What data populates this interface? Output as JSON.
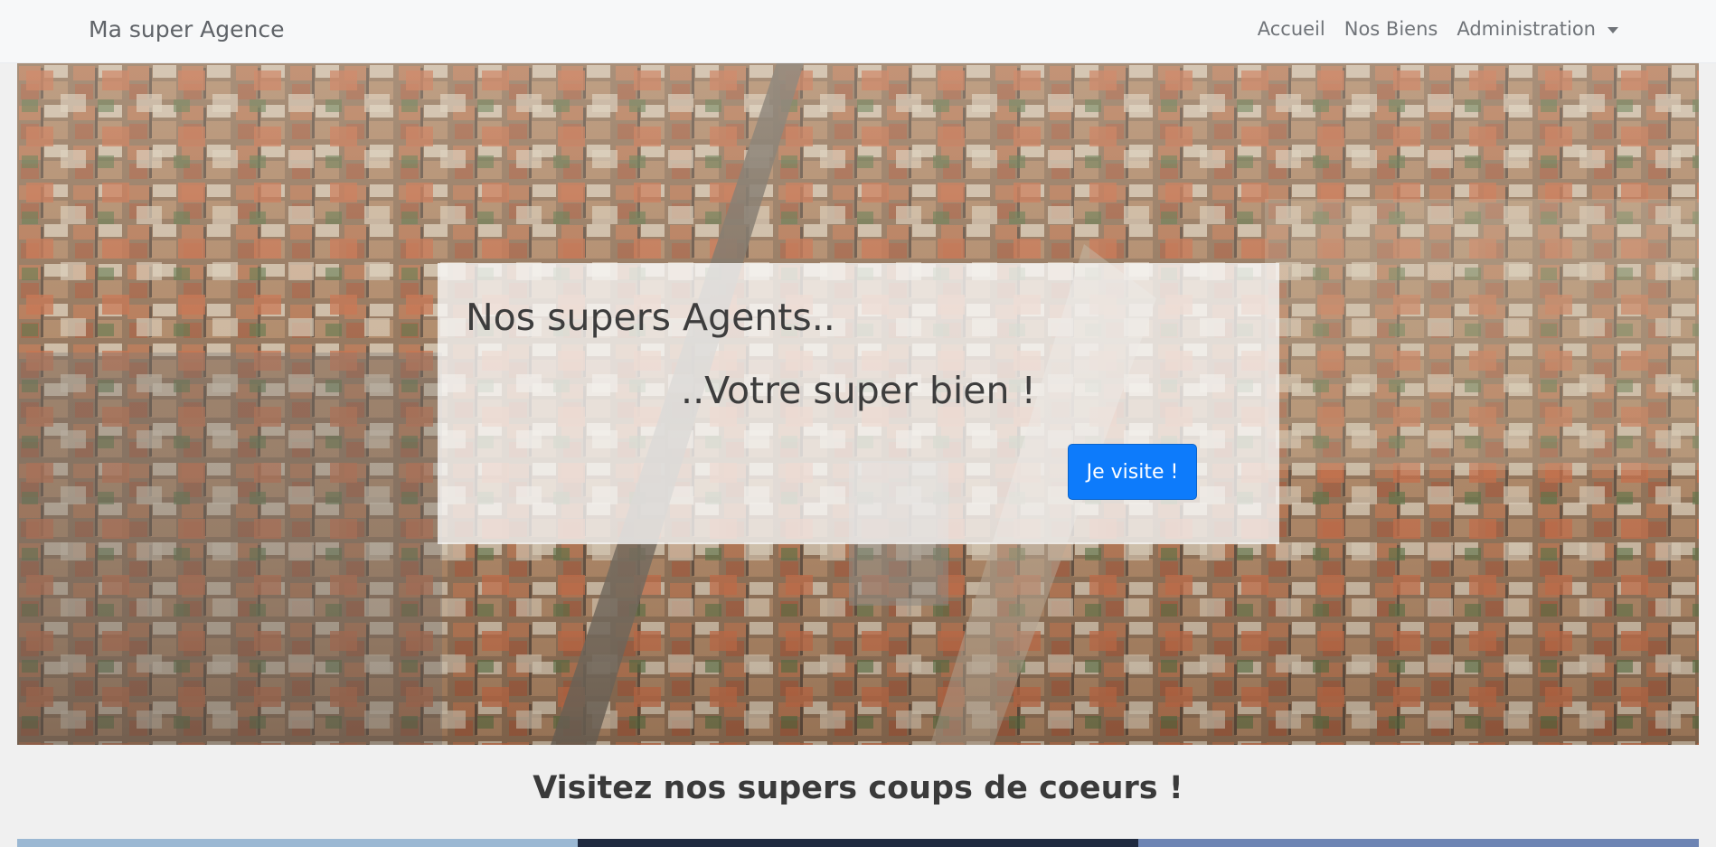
{
  "navbar": {
    "brand": "Ma super Agence",
    "links": [
      "Accueil",
      "Nos Biens"
    ],
    "dropdown_label": "Administration"
  },
  "hero": {
    "title": "Nos supers Agents..",
    "subtitle": "..Votre super bien !",
    "button_label": "Je visite !",
    "image": "aerial-city-rooftops-photo"
  },
  "section": {
    "title": "Visitez nos supers coups de coeurs !"
  },
  "colors": {
    "primary_button": "#0d7bfb",
    "navbar_bg": "#f7f8f9",
    "page_bg": "#f0f0f0",
    "card_colors": [
      "#9bb8d3",
      "#1f2a40",
      "#6d84b3"
    ]
  }
}
